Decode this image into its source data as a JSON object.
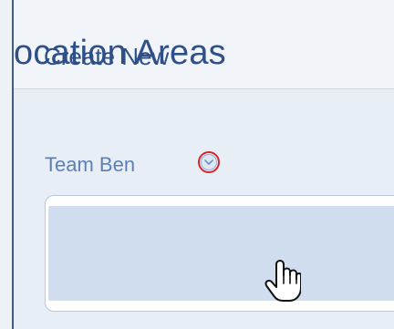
{
  "header": {
    "title": "ocation Areas"
  },
  "group": {
    "label": "Team Ben",
    "toggle_icon": "chevron-down-icon",
    "highlight_color": "#d8232a"
  },
  "menu": {
    "items": [
      {
        "label": "Create New"
      }
    ]
  },
  "cursor": {
    "type": "hand-pointer-icon"
  },
  "colors": {
    "accent": "#2f4f87",
    "label": "#5d7fb7",
    "selected_item_bg": "#cfddee",
    "panel_border": "#b7c7dc"
  }
}
